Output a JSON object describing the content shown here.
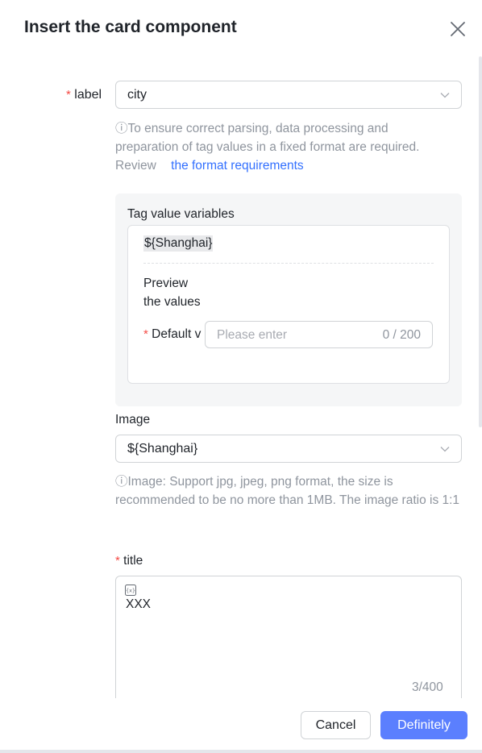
{
  "dialog": {
    "title": "Insert the card component"
  },
  "label_field": {
    "required_mark": "*",
    "label": "label",
    "value": "city"
  },
  "format_hint": {
    "text": "ⓘTo ensure correct parsing, data processing and preparation of tag values in a fixed format are required.",
    "review_prefix": "Review",
    "link_text": "the format requirements"
  },
  "tag_panel": {
    "title": "Tag value variables",
    "variable_chip": "${Shanghai}",
    "preview_line1": "Preview",
    "preview_line2": "the values",
    "default_required_mark": "*",
    "default_label": "Default v",
    "default_placeholder": "Please enter",
    "default_count": "0 / 200"
  },
  "image_field": {
    "label": "Image",
    "value": "${Shanghai}",
    "hint": "ⓘImage: Support jpg, jpeg, png format, the size is recommended to be no more than 1MB. The image ratio is 1:1"
  },
  "title_field": {
    "required_mark": "*",
    "label": "title",
    "value": "XXX",
    "count": "3/400"
  },
  "footer": {
    "cancel_label": "Cancel",
    "confirm_label": "Definitely"
  },
  "colors": {
    "primary": "#5b7ffe",
    "link": "#3370ff",
    "required": "#f54a45",
    "hint": "#8f959e"
  }
}
